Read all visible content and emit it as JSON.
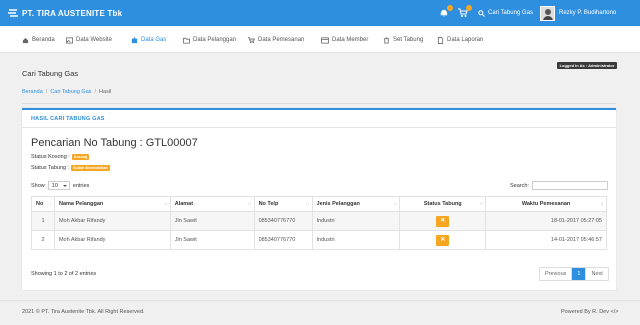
{
  "brand": {
    "name": "PT. TIRA AUSTENITE Tbk"
  },
  "topbar": {
    "search_label": "Cari Tabung Gas",
    "user_name": "Rezky P. Budihartono"
  },
  "nav": [
    {
      "label": "Beranda",
      "icon": "home-icon"
    },
    {
      "label": "Data Website",
      "icon": "image-icon"
    },
    {
      "label": "Data Gas",
      "icon": "cylinder-icon",
      "active": true
    },
    {
      "label": "Data Pelanggan",
      "icon": "folder-icon"
    },
    {
      "label": "Data Pemesanan",
      "icon": "cart-icon"
    },
    {
      "label": "Data Member",
      "icon": "card-icon"
    },
    {
      "label": "Set Tabung",
      "icon": "trash-icon"
    },
    {
      "label": "Data Laporan",
      "icon": "file-icon"
    }
  ],
  "logged_in": "Logged In As : Administrator",
  "page_title": "Cari Tabung Gas",
  "breadcrumb": [
    "Beranda",
    "Cari Tabung Gas",
    "Hasil"
  ],
  "card": {
    "header": "HASIL CARI TABUNG GAS",
    "search_title": "Pencarian No Tabung : GTL00007",
    "status_kosong_label": "Status Kosong :",
    "status_kosong_value": "Kosong",
    "status_tabung_label": "Status Tabung :",
    "status_tabung_value": "Sudah dikembalikan"
  },
  "table": {
    "show_label": "Show",
    "entries_value": "10",
    "entries_label": "entries",
    "search_label": "Search:",
    "columns": [
      "No",
      "Nama Pelanggan",
      "Alamat",
      "No Telp",
      "Jenis Pelanggan",
      "Status Tabung",
      "Waktu Pemesanan"
    ],
    "rows": [
      {
        "no": "1",
        "nama": "Moh Akbar Rifandy",
        "alamat": "Jln Sawit",
        "telp": "085340776770",
        "jenis": "Industri",
        "status": "✕",
        "waktu": "18-01-2017 05:27:05"
      },
      {
        "no": "2",
        "nama": "Moh Akbar Rifandy",
        "alamat": "Jln Sawit",
        "telp": "085340776770",
        "jenis": "Industri",
        "status": "✕",
        "waktu": "14-01-2017 05:46:57"
      }
    ],
    "showing": "Showing 1 to 2 of 2 entries",
    "pager": {
      "prev": "Previous",
      "page": "1",
      "next": "Next"
    }
  },
  "footer": {
    "left": "2021 © PT. Tira Austenite Tbk. All Right Reserved.",
    "right": "Powered By R. Dev </>"
  },
  "colors": {
    "primary": "#2e8fe0",
    "warning": "#f5a623"
  }
}
